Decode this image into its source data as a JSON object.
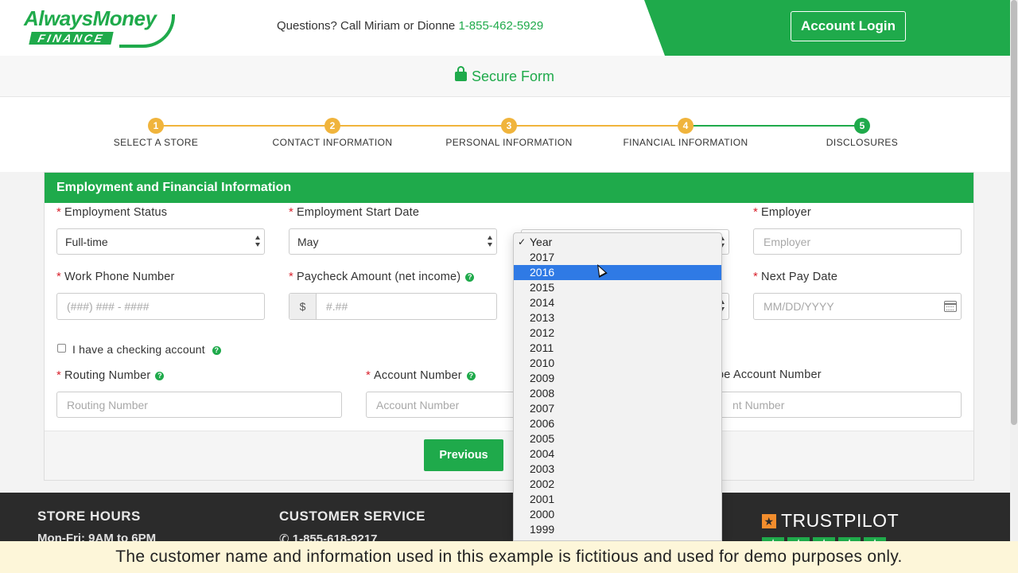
{
  "header": {
    "logo_top": "AlwaysMoney",
    "logo_bottom": "FINANCE",
    "questions_text": "Questions? Call Miriam or Dionne",
    "phone": "1-855-462-5929",
    "login_label": "Account Login",
    "accent_color": "#1faa4b"
  },
  "secure": {
    "label": "Secure Form",
    "icon": "lock-icon"
  },
  "steps": [
    {
      "num": "1",
      "label": "SELECT A STORE",
      "color": "#f0b43c"
    },
    {
      "num": "2",
      "label": "CONTACT INFORMATION",
      "color": "#f0b43c"
    },
    {
      "num": "3",
      "label": "PERSONAL INFORMATION",
      "color": "#f0b43c"
    },
    {
      "num": "4",
      "label": "FINANCIAL INFORMATION",
      "color": "#f0b43c"
    },
    {
      "num": "5",
      "label": "DISCLOSURES",
      "color": "#1faa4b"
    }
  ],
  "panel": {
    "title": "Employment and Financial Information",
    "req_mark": "*",
    "employment_status": {
      "label": "Employment Status",
      "value": "Full-time"
    },
    "start_date": {
      "label": "Employment Start Date",
      "month": "May"
    },
    "employer": {
      "label": "Employer",
      "placeholder": "Employer"
    },
    "work_phone": {
      "label": "Work Phone Number",
      "placeholder": "(###) ### - ####"
    },
    "paycheck": {
      "label": "Paycheck Amount (net income)",
      "prefix": "$",
      "placeholder": "#.##"
    },
    "next_pay": {
      "label": "Next Pay Date",
      "placeholder": "MM/DD/YYYY"
    },
    "checking": {
      "label": "I have a checking account",
      "checked": false
    },
    "routing": {
      "label": "Routing Number",
      "placeholder": "Routing Number"
    },
    "account": {
      "label": "Account Number",
      "placeholder": "Account Number"
    },
    "retype": {
      "label": "pe Account Number",
      "placeholder": "nt Number"
    },
    "help_glyph": "?",
    "previous_label": "Previous"
  },
  "year_dropdown": {
    "tick": "✓",
    "selected": "2016",
    "options": [
      "Year",
      "2017",
      "2016",
      "2015",
      "2014",
      "2013",
      "2012",
      "2011",
      "2010",
      "2009",
      "2008",
      "2007",
      "2006",
      "2005",
      "2004",
      "2003",
      "2002",
      "2001",
      "2000",
      "1999"
    ]
  },
  "footer": {
    "store_hours_title": "STORE HOURS",
    "store_hours_text": "Mon-Fri: 9AM to 6PM",
    "customer_service_title": "CUSTOMER SERVICE",
    "customer_service_phone": "1-855-618-9217",
    "trustpilot": "TRUSTPILOT"
  },
  "demo_notice": "The customer name and information used in this example is fictitious and used for demo purposes only."
}
